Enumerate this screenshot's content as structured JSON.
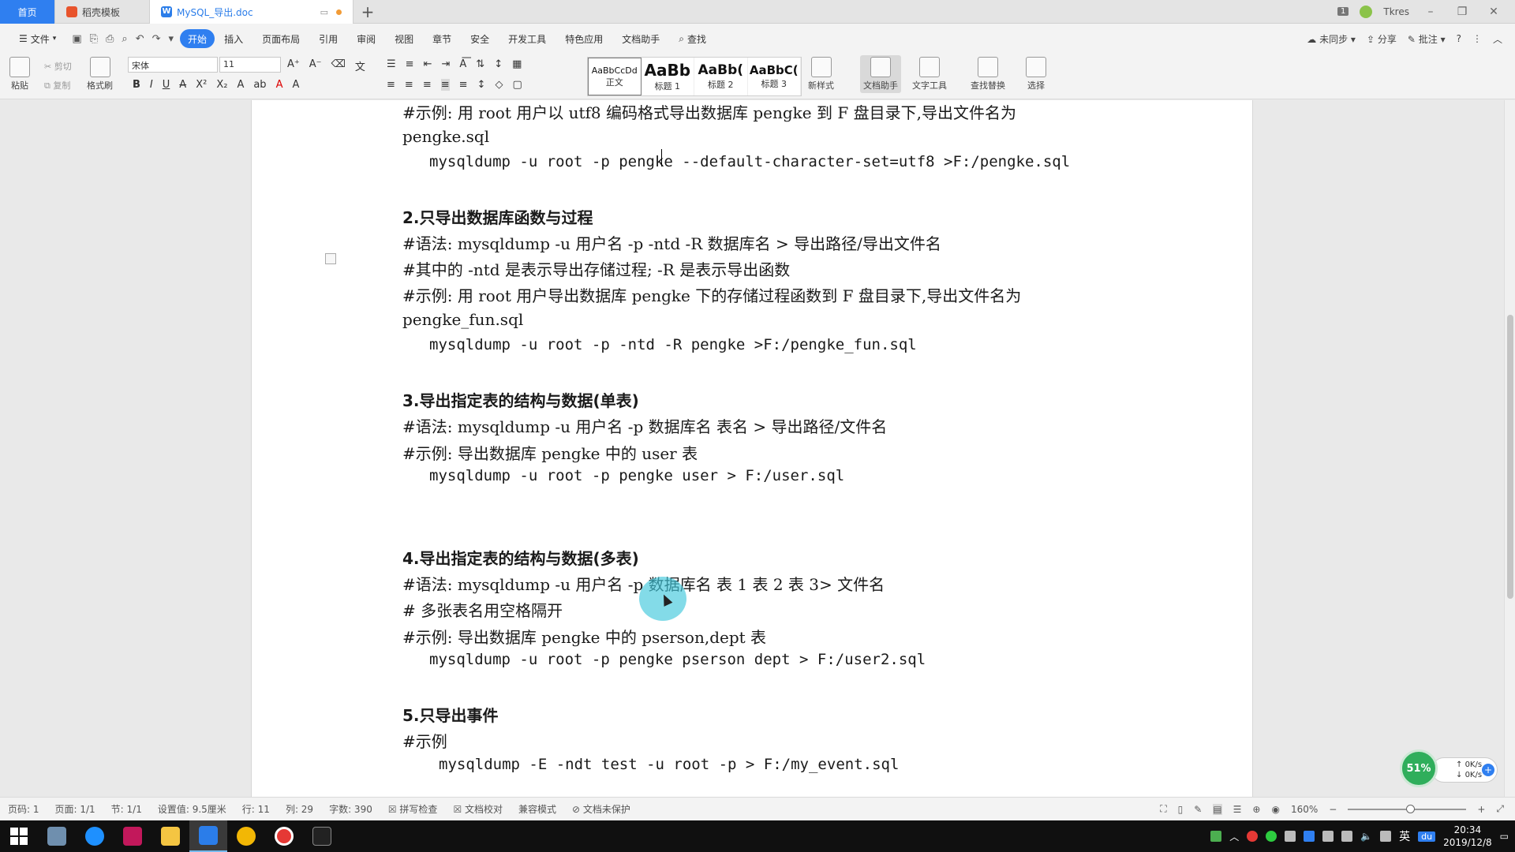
{
  "tabs": {
    "home": "首页",
    "template": "稻壳模板",
    "document": "MySQL_导出.doc",
    "user": "Tkres",
    "window_count": "1"
  },
  "menu": {
    "file": "文件",
    "items": [
      "开始",
      "插入",
      "页面布局",
      "引用",
      "审阅",
      "视图",
      "章节",
      "安全",
      "开发工具",
      "特色应用",
      "文档助手"
    ],
    "search": "查找",
    "right": [
      "未同步",
      "分享",
      "批注"
    ]
  },
  "ribbon": {
    "paste": "粘贴",
    "cut": "剪切",
    "copy": "复制",
    "format_painter": "格式刷",
    "font_name": "宋体",
    "font_size": "11",
    "styles": [
      {
        "sample": "AaBbCcDd",
        "label": "正文"
      },
      {
        "sample": "AaBb",
        "label": "标题 1"
      },
      {
        "sample": "AaBb(",
        "label": "标题 2"
      },
      {
        "sample": "AaBbC(",
        "label": "标题 3"
      }
    ],
    "new_style": "新样式",
    "doc_assistant": "文档助手",
    "text_tools": "文字工具",
    "find_replace": "查找替换",
    "select": "选择"
  },
  "document": {
    "lines": [
      "#示例: 用 root 用户以 utf8 编码格式导出数据库 pengke 到 F 盘目录下,导出文件名为",
      "pengke.sql",
      "mysqldump -u root -p pengke --default-character-set=utf8 >F:/pengke.sql",
      "2.只导出数据库函数与过程",
      "#语法: mysqldump -u 用户名 -p -ntd -R  数据库名 >  导出路径/导出文件名",
      "#其中的 -ntd 是表示导出存储过程; -R 是表示导出函数",
      "#示例: 用 root 用户导出数据库 pengke 下的存储过程函数到 F 盘目录下,导出文件名为",
      "pengke_fun.sql",
      "mysqldump -u root -p -ntd -R  pengke >F:/pengke_fun.sql",
      "3.导出指定表的结构与数据(单表)",
      "#语法: mysqldump -u 用户名 -p 数据库名 表名 > 导出路径/文件名",
      "#示例: 导出数据库 pengke 中的 user 表",
      "mysqldump -u root -p pengke user > F:/user.sql",
      "4.导出指定表的结构与数据(多表)",
      "#语法: mysqldump -u 用户名 -p 数据库名 表 1 表 2 表 3> 文件名",
      "#  多张表名用空格隔开",
      "#示例: 导出数据库 pengke 中的 pserson,dept 表",
      "mysqldump -u root -p pengke pserson dept > F:/user2.sql",
      "5.只导出事件",
      "#示例",
      "mysqldump -E -ndt test -u root -p > F:/my_event.sql"
    ]
  },
  "status": {
    "page_no": "页码: 1",
    "page": "页面: 1/1",
    "section": "节: 1/1",
    "setting": "设置值: 9.5厘米",
    "row": "行: 11",
    "col": "列: 29",
    "words": "字数: 390",
    "spell": "拼写检查",
    "proof": "文档校对",
    "compat": "兼容模式",
    "protect": "文档未保护",
    "zoom": "160%"
  },
  "net": {
    "percent": "51%",
    "up": "0K/s",
    "down": "0K/s"
  },
  "taskbar": {
    "ime": "英",
    "du": "du",
    "time": "20:34",
    "date": "2019/12/8"
  }
}
